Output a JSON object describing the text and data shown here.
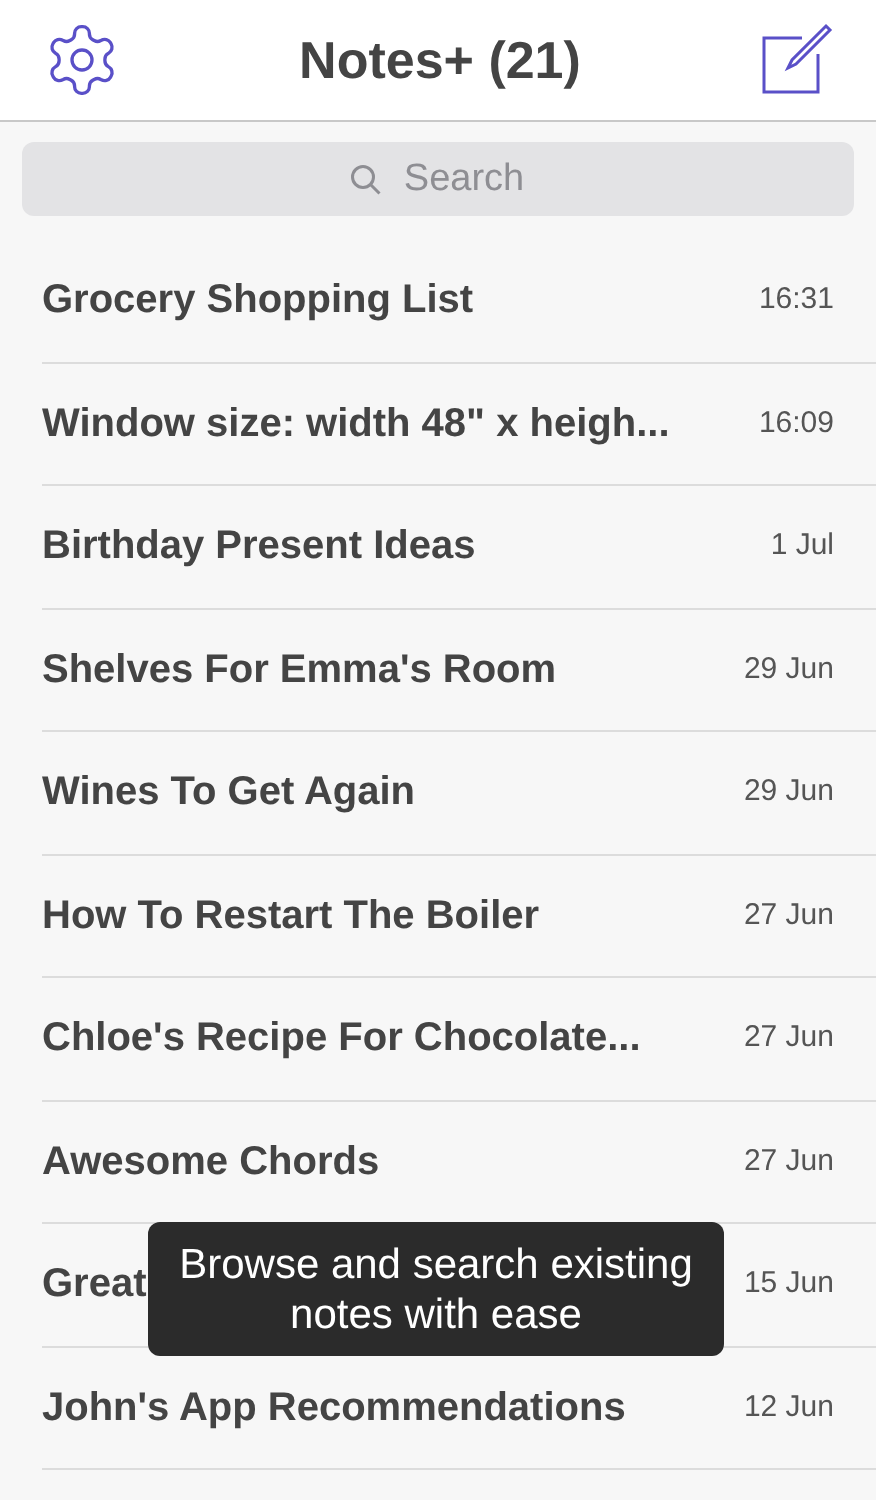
{
  "header": {
    "title": "Notes+ (21)"
  },
  "search": {
    "placeholder": "Search"
  },
  "notes": [
    {
      "title": "Grocery Shopping List",
      "date": "16:31"
    },
    {
      "title": "Window size: width 48\" x heigh...",
      "date": "16:09"
    },
    {
      "title": "Birthday Present Ideas",
      "date": "1 Jul"
    },
    {
      "title": "Shelves For Emma's Room",
      "date": "29 Jun"
    },
    {
      "title": "Wines To Get Again",
      "date": "29 Jun"
    },
    {
      "title": "How To Restart The Boiler",
      "date": "27 Jun"
    },
    {
      "title": "Chloe's Recipe For Chocolate...",
      "date": "27 Jun"
    },
    {
      "title": "Awesome Chords",
      "date": "27 Jun"
    },
    {
      "title": "Great",
      "date": "15 Jun"
    },
    {
      "title": "John's App Recommendations",
      "date": "12 Jun"
    }
  ],
  "tooltip": {
    "text": "Browse and search existing notes with ease"
  }
}
